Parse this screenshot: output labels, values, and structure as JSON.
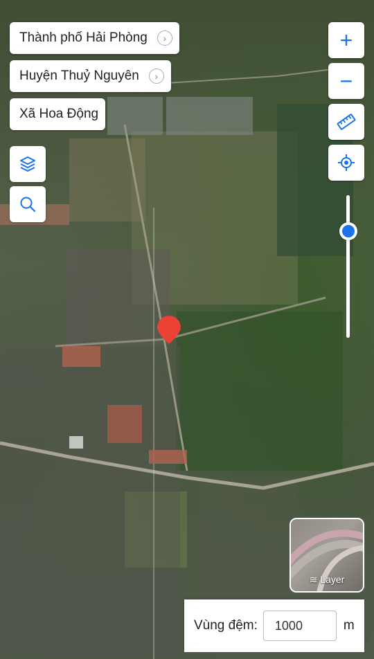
{
  "breadcrumbs": [
    {
      "label": "Thành phố Hải Phòng",
      "has_chevron": true
    },
    {
      "label": "Huyện Thuỷ Nguyên",
      "has_chevron": true
    },
    {
      "label": "Xã Hoa Động",
      "has_chevron": false
    }
  ],
  "controls": {
    "zoom_in": "+",
    "zoom_out": "−",
    "icons": [
      "layers-icon",
      "search-icon",
      "ruler-icon",
      "locate-icon",
      "plus-icon",
      "minus-icon",
      "map-pin-icon"
    ]
  },
  "zoom_slider": {
    "level": 0.25
  },
  "layer_switcher": {
    "label": "Layer"
  },
  "buffer": {
    "label": "Vùng đệm:",
    "value": "1000",
    "unit": "m"
  },
  "colors": {
    "accent": "#1a73e8",
    "marker": "#ea4335"
  }
}
